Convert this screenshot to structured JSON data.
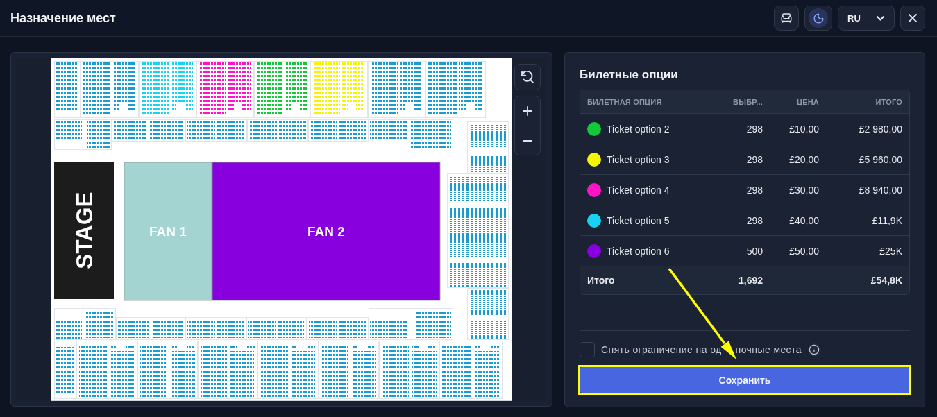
{
  "header": {
    "title": "Назначение мест",
    "dark_mode": true,
    "language": "RU"
  },
  "seat_map": {
    "stage_label": "STAGE",
    "zones": [
      {
        "label": "FAN 1",
        "color": "#a3d4d2"
      },
      {
        "label": "FAN 2",
        "color": "#8800dd"
      }
    ],
    "sections": [
      {
        "color": "#1a9bd1"
      },
      {
        "color": "#1a9bd1"
      },
      {
        "color": "#16d3f3"
      },
      {
        "color": "#ff12c8"
      },
      {
        "color": "#12c93a"
      },
      {
        "color": "#f7f400"
      },
      {
        "color": "#1a9bd1"
      },
      {
        "color": "#1a9bd1"
      },
      {
        "color": "#1a9bd1"
      },
      {
        "color": "#1a9bd1"
      },
      {
        "color": "#1a9bd1"
      },
      {
        "color": "#1a9bd1"
      },
      {
        "color": "#1a9bd1"
      },
      {
        "color": "#1a9bd1"
      },
      {
        "color": "#1a9bd1"
      },
      {
        "color": "#1a9bd1"
      },
      {
        "color": "#1a9bd1"
      },
      {
        "color": "#1a9bd1"
      },
      {
        "color": "#1a9bd1"
      },
      {
        "color": "#1a9bd1"
      },
      {
        "color": "#1a9bd1"
      },
      {
        "color": "#1a9bd1"
      },
      {
        "color": "#1a9bd1"
      },
      {
        "color": "#1a9bd1"
      },
      {
        "color": "#1a9bd1"
      },
      {
        "color": "#1a9bd1"
      },
      {
        "color": "#1a9bd1"
      },
      {
        "color": "#1a9bd1"
      },
      {
        "color": "#1a9bd1"
      },
      {
        "color": "#1a9bd1"
      },
      {
        "color": "#1a9bd1"
      }
    ]
  },
  "ticket_options": {
    "title": "Билетные опции",
    "columns": [
      "БИЛЕТНАЯ ОПЦИЯ",
      "ВЫБР...",
      "ЦЕНА",
      "ИТОГО"
    ],
    "rows": [
      {
        "name": "Ticket option 2",
        "color": "#12c93a",
        "count": "298",
        "price": "£10,00",
        "total": "£2 980,00"
      },
      {
        "name": "Ticket option 3",
        "color": "#f7f400",
        "count": "298",
        "price": "£20,00",
        "total": "£5 960,00"
      },
      {
        "name": "Ticket option 4",
        "color": "#ff12c8",
        "count": "298",
        "price": "£30,00",
        "total": "£8 940,00"
      },
      {
        "name": "Ticket option 5",
        "color": "#16d3f3",
        "count": "298",
        "price": "£40,00",
        "total": "£11,9K"
      },
      {
        "name": "Ticket option 6",
        "color": "#8800dd",
        "count": "500",
        "price": "£50,00",
        "total": "£25K"
      }
    ],
    "total_row": {
      "label": "Итого",
      "count": "1,692",
      "total": "£54,8K"
    }
  },
  "single_seats": {
    "label_parts": [
      "Снять ограничение на од",
      "ночные места"
    ],
    "checked": false
  },
  "save_button": {
    "label": "Сохранить"
  },
  "annotations": {
    "arrow": true,
    "save_highlight": true
  }
}
